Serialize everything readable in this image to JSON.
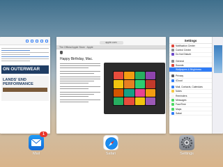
{
  "apps": {
    "mail": {
      "label": "Mail",
      "badge": "1"
    },
    "safari": {
      "label": "Safari"
    },
    "settings": {
      "label": "Settings"
    }
  },
  "mail_card": {
    "ad_banner_1": "ON OUTERWEAR",
    "ad_banner_2_line_1": "LANDS' END",
    "ad_banner_2_line_2": "PERFORMANCE"
  },
  "safari_card": {
    "url": "apple.com",
    "tab_text": "The Official Apple Store · Apple",
    "headline": "Happy Birthday, Mac."
  },
  "settings_card": {
    "title": "Settings",
    "rows": [
      {
        "label": "Notification Center",
        "icon_color": "#e0463a"
      },
      {
        "label": "Control Center",
        "icon_color": "#8a8a8f"
      },
      {
        "label": "Do Not Disturb",
        "icon_color": "#6b47c9"
      },
      {
        "label": "General",
        "icon_color": "#8a8a8f"
      },
      {
        "label": "Sounds",
        "icon_color": "#e0463a"
      },
      {
        "label": "Wallpapers & Brightness",
        "icon_color": "#2f7cf6",
        "selected": true
      },
      {
        "label": "Privacy",
        "icon_color": "#5a5a5f"
      },
      {
        "label": "iCloud",
        "icon_color": "#2f7cf6"
      },
      {
        "label": "Mail, Contacts, Calendars",
        "icon_color": "#2f7cf6"
      },
      {
        "label": "Notes",
        "icon_color": "#f5c843"
      },
      {
        "label": "Reminders",
        "icon_color": "#f5f5f5"
      },
      {
        "label": "Messages",
        "icon_color": "#4cd964"
      },
      {
        "label": "FaceTime",
        "icon_color": "#4cd964"
      },
      {
        "label": "Maps",
        "icon_color": "#4cd964"
      },
      {
        "label": "Safari",
        "icon_color": "#2f7cf6"
      }
    ]
  },
  "colors": {
    "accent": "#2f7cf6",
    "badge": "#e8352b"
  }
}
